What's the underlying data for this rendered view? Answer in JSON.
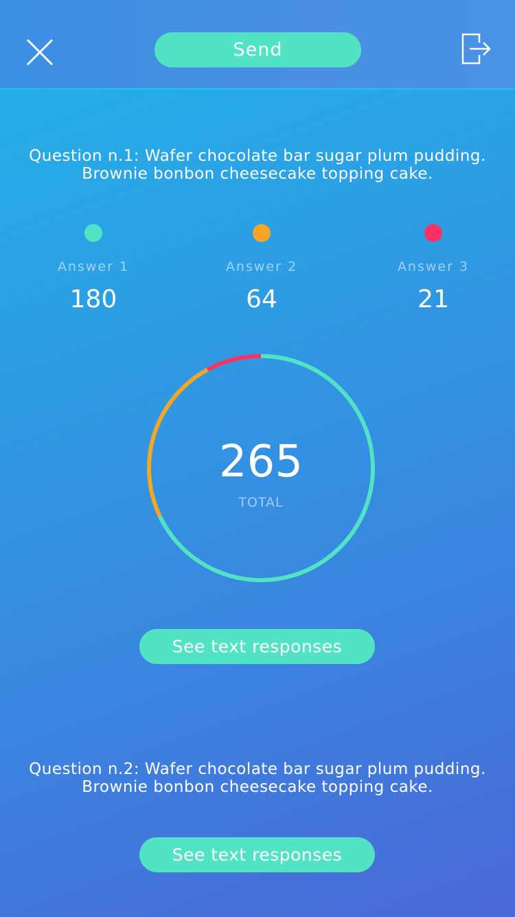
{
  "header": {
    "send_label": "Send"
  },
  "colors": {
    "answer1": "#52e3c4",
    "answer2": "#f5a623",
    "answer3": "#fb3365"
  },
  "questions": [
    {
      "title_line1": "Question n.1: Wafer chocolate bar sugar plum pudding.",
      "title_line2": "Brownie bonbon cheesecake topping cake.",
      "answers": [
        {
          "label": "Answer 1",
          "count": "180"
        },
        {
          "label": "Answer 2",
          "count": "64"
        },
        {
          "label": "Answer 3",
          "count": "21"
        }
      ],
      "total": "265",
      "total_label": "TOTAL",
      "responses_label": "See text responses"
    },
    {
      "title_line1": "Question n.2: Wafer chocolate bar sugar plum pudding.",
      "title_line2": "Brownie bonbon cheesecake topping cake.",
      "responses_label": "See text responses"
    }
  ],
  "chart_data": {
    "type": "pie",
    "categories": [
      "Answer 1",
      "Answer 2",
      "Answer 3"
    ],
    "values": [
      180,
      64,
      21
    ],
    "total": 265
  }
}
